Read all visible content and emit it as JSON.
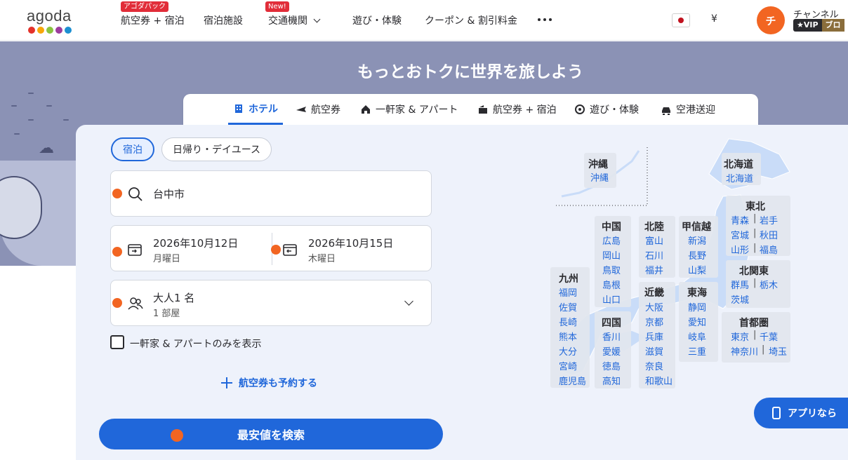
{
  "header": {
    "logo_text": "agoda",
    "logo_colors": [
      "#e4322a",
      "#f7a70a",
      "#8ac43f",
      "#9c3c9e",
      "#1c8fd1"
    ],
    "nav": [
      {
        "label": "航空券 + 宿泊",
        "badge": "アゴダパック"
      },
      {
        "label": "宿泊施設",
        "badge": ""
      },
      {
        "label": "交通機関",
        "badge": "New!"
      },
      {
        "label": "遊び・体験",
        "badge": ""
      },
      {
        "label": "クーポン & 割引料金",
        "badge": ""
      }
    ],
    "currency": "¥",
    "user_initial": "チ",
    "user_name": "チャンネル",
    "vip_label": "★VIP",
    "vip_tier": "ブロ"
  },
  "hero": {
    "title": "もっとおトクに世界を旅しよう"
  },
  "tabs": [
    {
      "label": "ホテル",
      "icon": "hotel-icon",
      "active": true
    },
    {
      "label": "航空券",
      "icon": "plane-icon",
      "active": false
    },
    {
      "label": "一軒家 & アパート",
      "icon": "house-icon",
      "active": false
    },
    {
      "label": "航空券 + 宿泊",
      "icon": "package-icon",
      "active": false
    },
    {
      "label": "遊び・体験",
      "icon": "activity-icon",
      "active": false
    },
    {
      "label": "空港送迎",
      "icon": "car-icon",
      "active": false
    }
  ],
  "search": {
    "stay_types": [
      "宿泊",
      "日帰り・デイユース"
    ],
    "destination": "台中市",
    "checkin_date": "2026年10月12日",
    "checkin_day": "月曜日",
    "checkout_date": "2026年10月15日",
    "checkout_day": "木曜日",
    "guests": "大人1 名",
    "rooms": "1 部屋",
    "homes_only_label": "一軒家 & アパートのみを表示",
    "add_flight_label": "航空券も予約する",
    "search_button": "最安値を検索"
  },
  "app_button": "アプリなら",
  "map": {
    "okinawa": {
      "name": "沖縄",
      "prefs": [
        "沖縄"
      ]
    },
    "hokkaido": {
      "name": "北海道",
      "prefs": [
        "北海道"
      ]
    },
    "tohoku": {
      "name": "東北",
      "prefs": [
        "青森",
        "岩手",
        "宮城",
        "秋田",
        "山形",
        "福島"
      ]
    },
    "chugoku": {
      "name": "中国",
      "prefs": [
        "広島",
        "岡山",
        "鳥取",
        "島根",
        "山口"
      ]
    },
    "hokuriku": {
      "name": "北陸",
      "prefs": [
        "富山",
        "石川",
        "福井"
      ]
    },
    "koshinetsu": {
      "name": "甲信越",
      "prefs": [
        "新潟",
        "長野",
        "山梨"
      ]
    },
    "kitakanto": {
      "name": "北関東",
      "prefs": [
        "群馬",
        "栃木",
        "茨城"
      ]
    },
    "kyushu": {
      "name": "九州",
      "prefs": [
        "福岡",
        "佐賀",
        "長崎",
        "熊本",
        "大分",
        "宮崎",
        "鹿児島"
      ]
    },
    "kinki": {
      "name": "近畿",
      "prefs": [
        "大阪",
        "京都",
        "兵庫",
        "滋賀",
        "奈良",
        "和歌山"
      ]
    },
    "tokai": {
      "name": "東海",
      "prefs": [
        "静岡",
        "愛知",
        "岐阜",
        "三重"
      ]
    },
    "shikoku": {
      "name": "四国",
      "prefs": [
        "香川",
        "愛媛",
        "徳島",
        "高知"
      ]
    },
    "shutoken": {
      "name": "首都圏",
      "prefs": [
        "東京",
        "千葉",
        "神奈川",
        "埼玉"
      ]
    }
  }
}
